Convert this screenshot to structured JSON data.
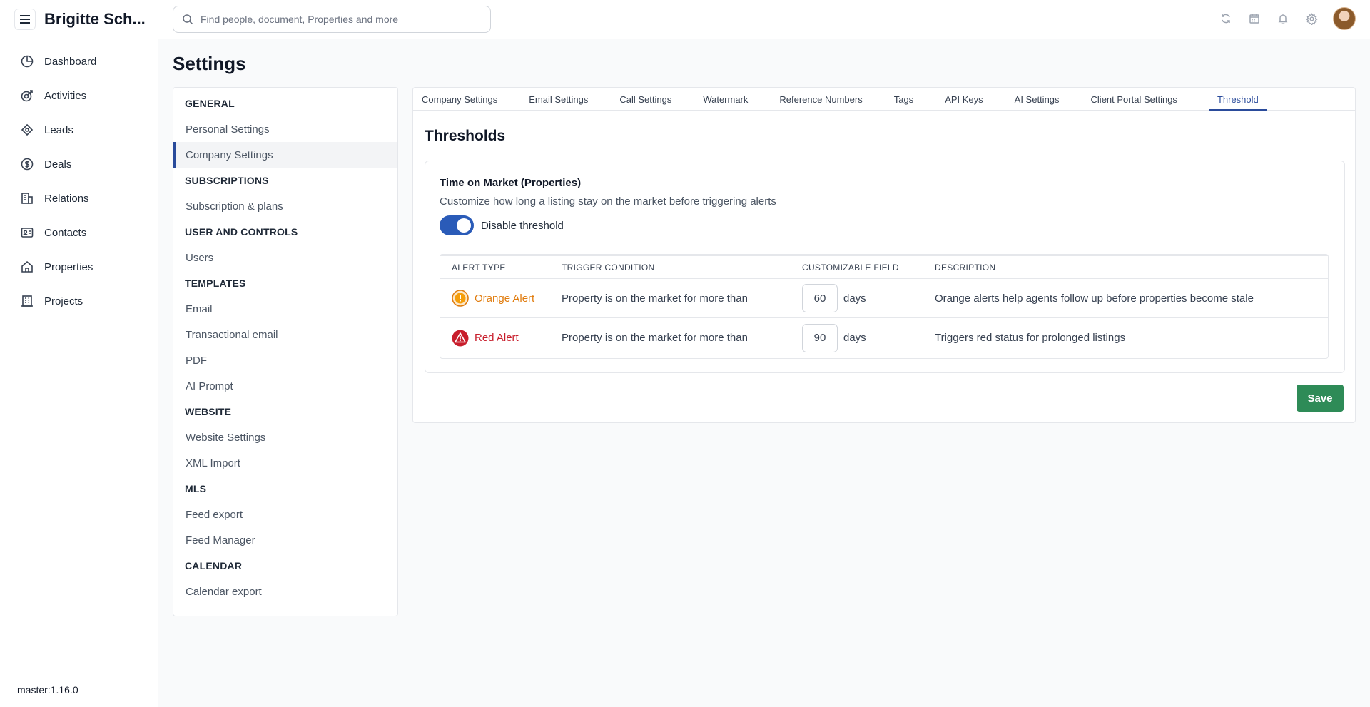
{
  "app": {
    "title": "Brigitte Sch...",
    "version": "master:1.16.0"
  },
  "nav": {
    "items": [
      {
        "label": "Dashboard",
        "icon": "dashboard-icon"
      },
      {
        "label": "Activities",
        "icon": "activities-icon"
      },
      {
        "label": "Leads",
        "icon": "leads-icon"
      },
      {
        "label": "Deals",
        "icon": "deals-icon"
      },
      {
        "label": "Relations",
        "icon": "relations-icon"
      },
      {
        "label": "Contacts",
        "icon": "contacts-icon"
      },
      {
        "label": "Properties",
        "icon": "properties-icon"
      },
      {
        "label": "Projects",
        "icon": "projects-icon"
      }
    ]
  },
  "search": {
    "placeholder": "Find people, document, Properties and more"
  },
  "page": {
    "title": "Settings"
  },
  "settings_menu": {
    "general": "GENERAL",
    "personal_settings": "Personal Settings",
    "company_settings": "Company Settings",
    "subscriptions": "SUBSCRIPTIONS",
    "subscription_plans": "Subscription & plans",
    "user_controls": "USER AND CONTROLS",
    "users": "Users",
    "templates": "TEMPLATES",
    "email": "Email",
    "transactional_email": "Transactional email",
    "pdf": "PDF",
    "ai_prompt": "AI Prompt",
    "website": "WEBSITE",
    "website_settings": "Website Settings",
    "xml_import": "XML Import",
    "mls": "MLS",
    "feed_export": "Feed export",
    "feed_manager": "Feed Manager",
    "calendar": "CALENDAR",
    "calendar_export": "Calendar export"
  },
  "tabs": {
    "company": "Company Settings",
    "email": "Email Settings",
    "call": "Call Settings",
    "watermark": "Watermark",
    "reference": "Reference Numbers",
    "tags": "Tags",
    "api": "API Keys",
    "ai": "AI Settings",
    "portal": "Client Portal Settings",
    "threshold": "Threshold"
  },
  "thresholds": {
    "title": "Thresholds",
    "card_title": "Time on Market (Properties)",
    "card_desc": "Customize how long a listing stay on the market before triggering alerts",
    "toggle_label": "Disable threshold",
    "toggle_on": true,
    "columns": {
      "alert_type": "ALERT TYPE",
      "trigger": "TRIGGER CONDITION",
      "field": "CUSTOMIZABLE FIELD",
      "description": "DESCRIPTION"
    },
    "rows": {
      "orange": {
        "label": "Orange Alert",
        "trigger": "Property is on the market for more than",
        "value": "60",
        "unit": "days",
        "description": "Orange alerts help agents follow up before properties become stale",
        "color": "#e07b0c"
      },
      "red": {
        "label": "Red Alert",
        "trigger": "Property is on the market for more than",
        "value": "90",
        "unit": "days",
        "description": "Triggers red status for prolonged listings",
        "color": "#c81e2c"
      }
    },
    "save_label": "Save"
  },
  "colors": {
    "accent": "#2a4b9b",
    "save": "#2e8b57",
    "toggle": "#2a5bb8"
  }
}
